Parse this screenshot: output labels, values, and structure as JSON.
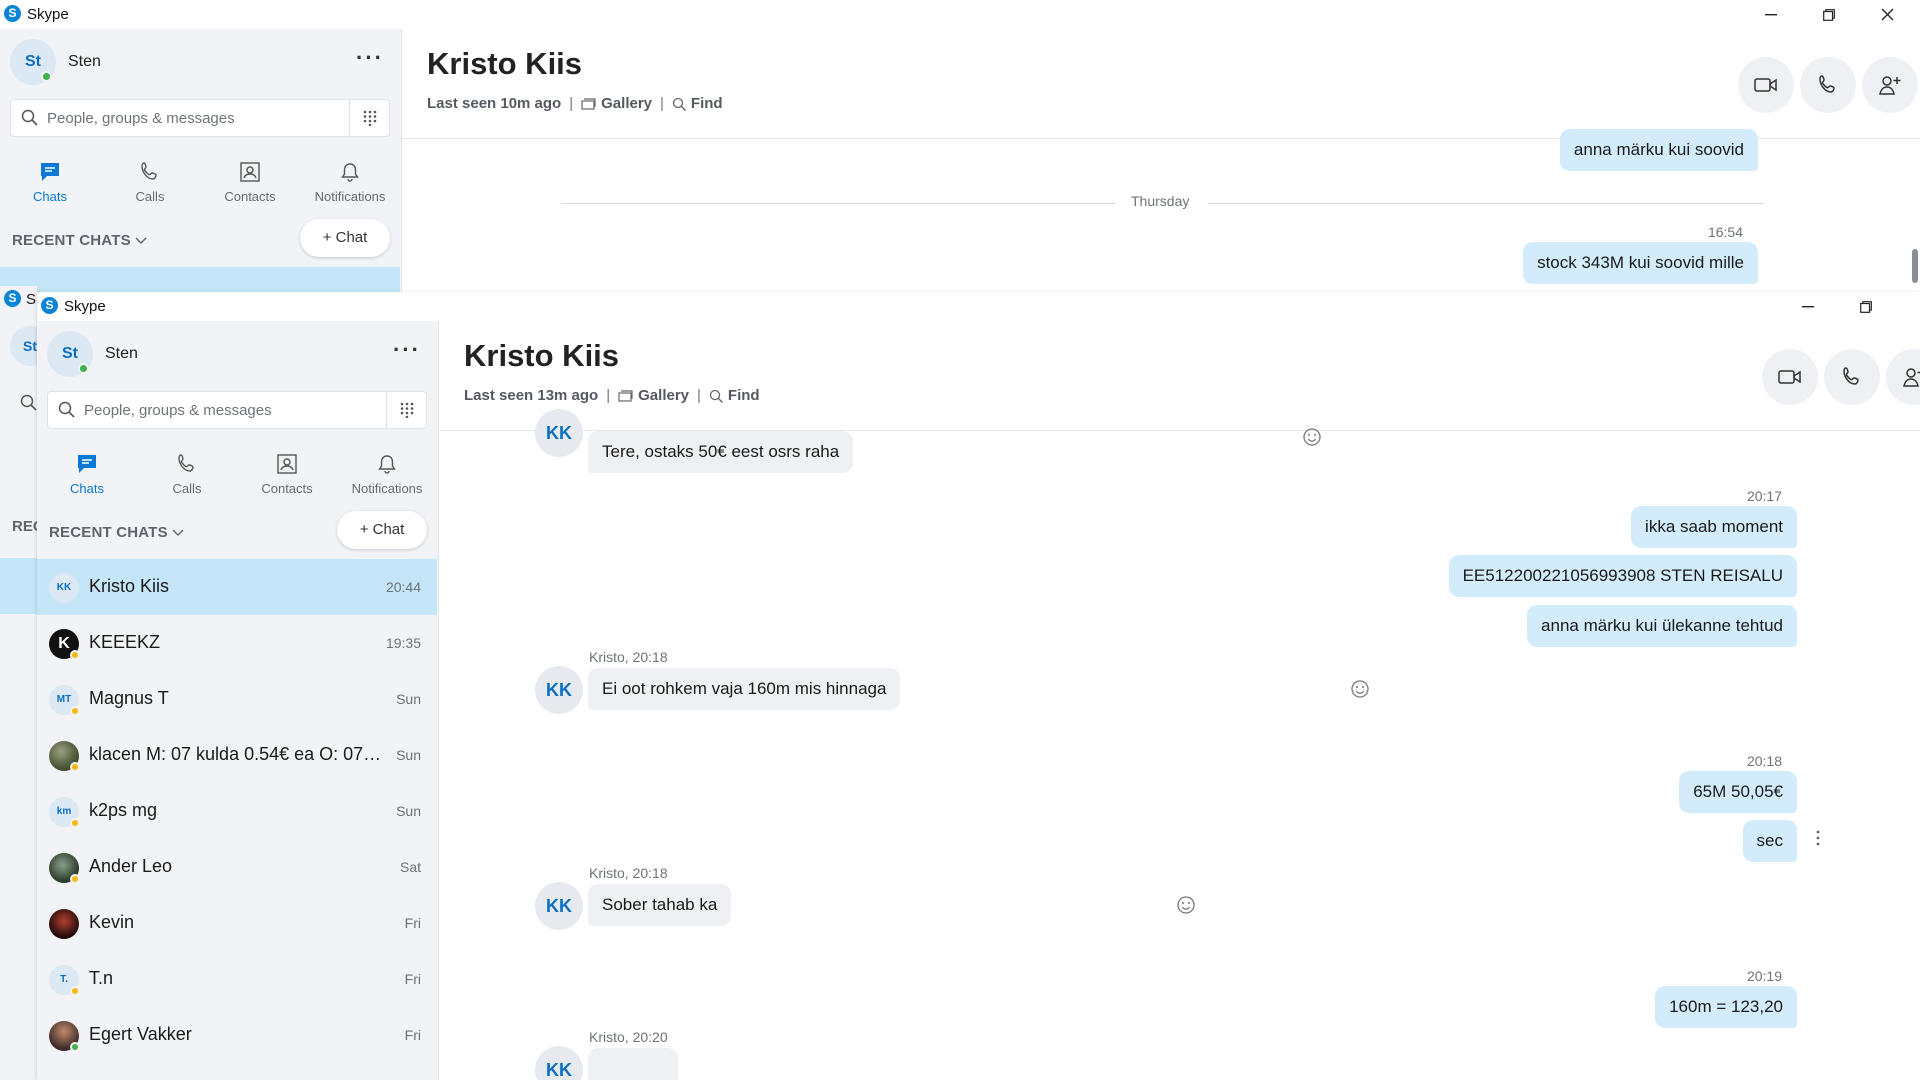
{
  "back_window": {
    "app_title": "Skype",
    "user": {
      "initials": "St",
      "name": "Sten"
    },
    "search_placeholder": "People, groups & messages",
    "nav": [
      {
        "label": "Chats"
      },
      {
        "label": "Calls"
      },
      {
        "label": "Contacts"
      },
      {
        "label": "Notifications"
      }
    ],
    "recent_chats_label": "RECENT CHATS",
    "new_chat_label": "Chat",
    "contact_name": "Kristo Kiis",
    "last_seen": "Last seen 10m ago",
    "gallery_label": "Gallery",
    "find_label": "Find",
    "messages": {
      "out_1": "anna märku kui soovid",
      "day_label": "Thursday",
      "time_1": "16:54",
      "out_2": "stock 343M kui soovid mille"
    }
  },
  "front_window": {
    "app_title": "Skype",
    "user": {
      "initials": "St",
      "name": "Sten"
    },
    "search_placeholder": "People, groups & messages",
    "nav": [
      {
        "label": "Chats"
      },
      {
        "label": "Calls"
      },
      {
        "label": "Contacts"
      },
      {
        "label": "Notifications"
      }
    ],
    "recent_chats_label": "RECENT CHATS",
    "new_chat_label": "Chat",
    "chats": [
      {
        "initials": "KK",
        "name": "Kristo Kiis",
        "time": "20:44"
      },
      {
        "initials": "K",
        "name": "KEEEKZ",
        "time": "19:35"
      },
      {
        "initials": "MT",
        "name": "Magnus T",
        "time": "Sun"
      },
      {
        "initials": "",
        "name": "klacen M: 07 kulda 0.54€ ea  O: 07…",
        "time": "Sun"
      },
      {
        "initials": "km",
        "name": "k2ps mg",
        "time": "Sun"
      },
      {
        "initials": "",
        "name": "Ander Leo",
        "time": "Sat"
      },
      {
        "initials": "",
        "name": "Kevin",
        "time": "Fri"
      },
      {
        "initials": "T.",
        "name": "T.n",
        "time": "Fri"
      },
      {
        "initials": "",
        "name": "Egert Vakker",
        "time": "Fri"
      }
    ],
    "contact_name": "Kristo Kiis",
    "last_seen": "Last seen 13m ago",
    "gallery_label": "Gallery",
    "find_label": "Find",
    "messages": {
      "in_0": "Tere, ostaks 50€ eest osrs raha",
      "time_1": "20:17",
      "out_1": "ikka saab moment",
      "out_2": "EE512200221056993908 STEN REISALU",
      "out_3": "anna märku kui ülekanne tehtud",
      "sender_1": "Kristo, 20:18",
      "in_1": "Ei oot rohkem vaja 160m mis hinnaga",
      "time_2": "20:18",
      "out_4": "65M 50,05€",
      "out_5": "sec",
      "sender_2": "Kristo, 20:18",
      "in_2": "Sober tahab ka",
      "time_3": "20:19",
      "out_6": "160m = 123,20",
      "sender_3": "Kristo, 20:20",
      "kk_initials": "KK"
    }
  },
  "behind_window_partial": {
    "app_title": "Sk",
    "user_initials": "St",
    "recent_label": "REC"
  },
  "colors": {
    "accent": "#0a78d4",
    "bubble_out": "#d3ecfb",
    "bubble_in": "#eef0f3",
    "selected_row": "#c5e5f8"
  }
}
